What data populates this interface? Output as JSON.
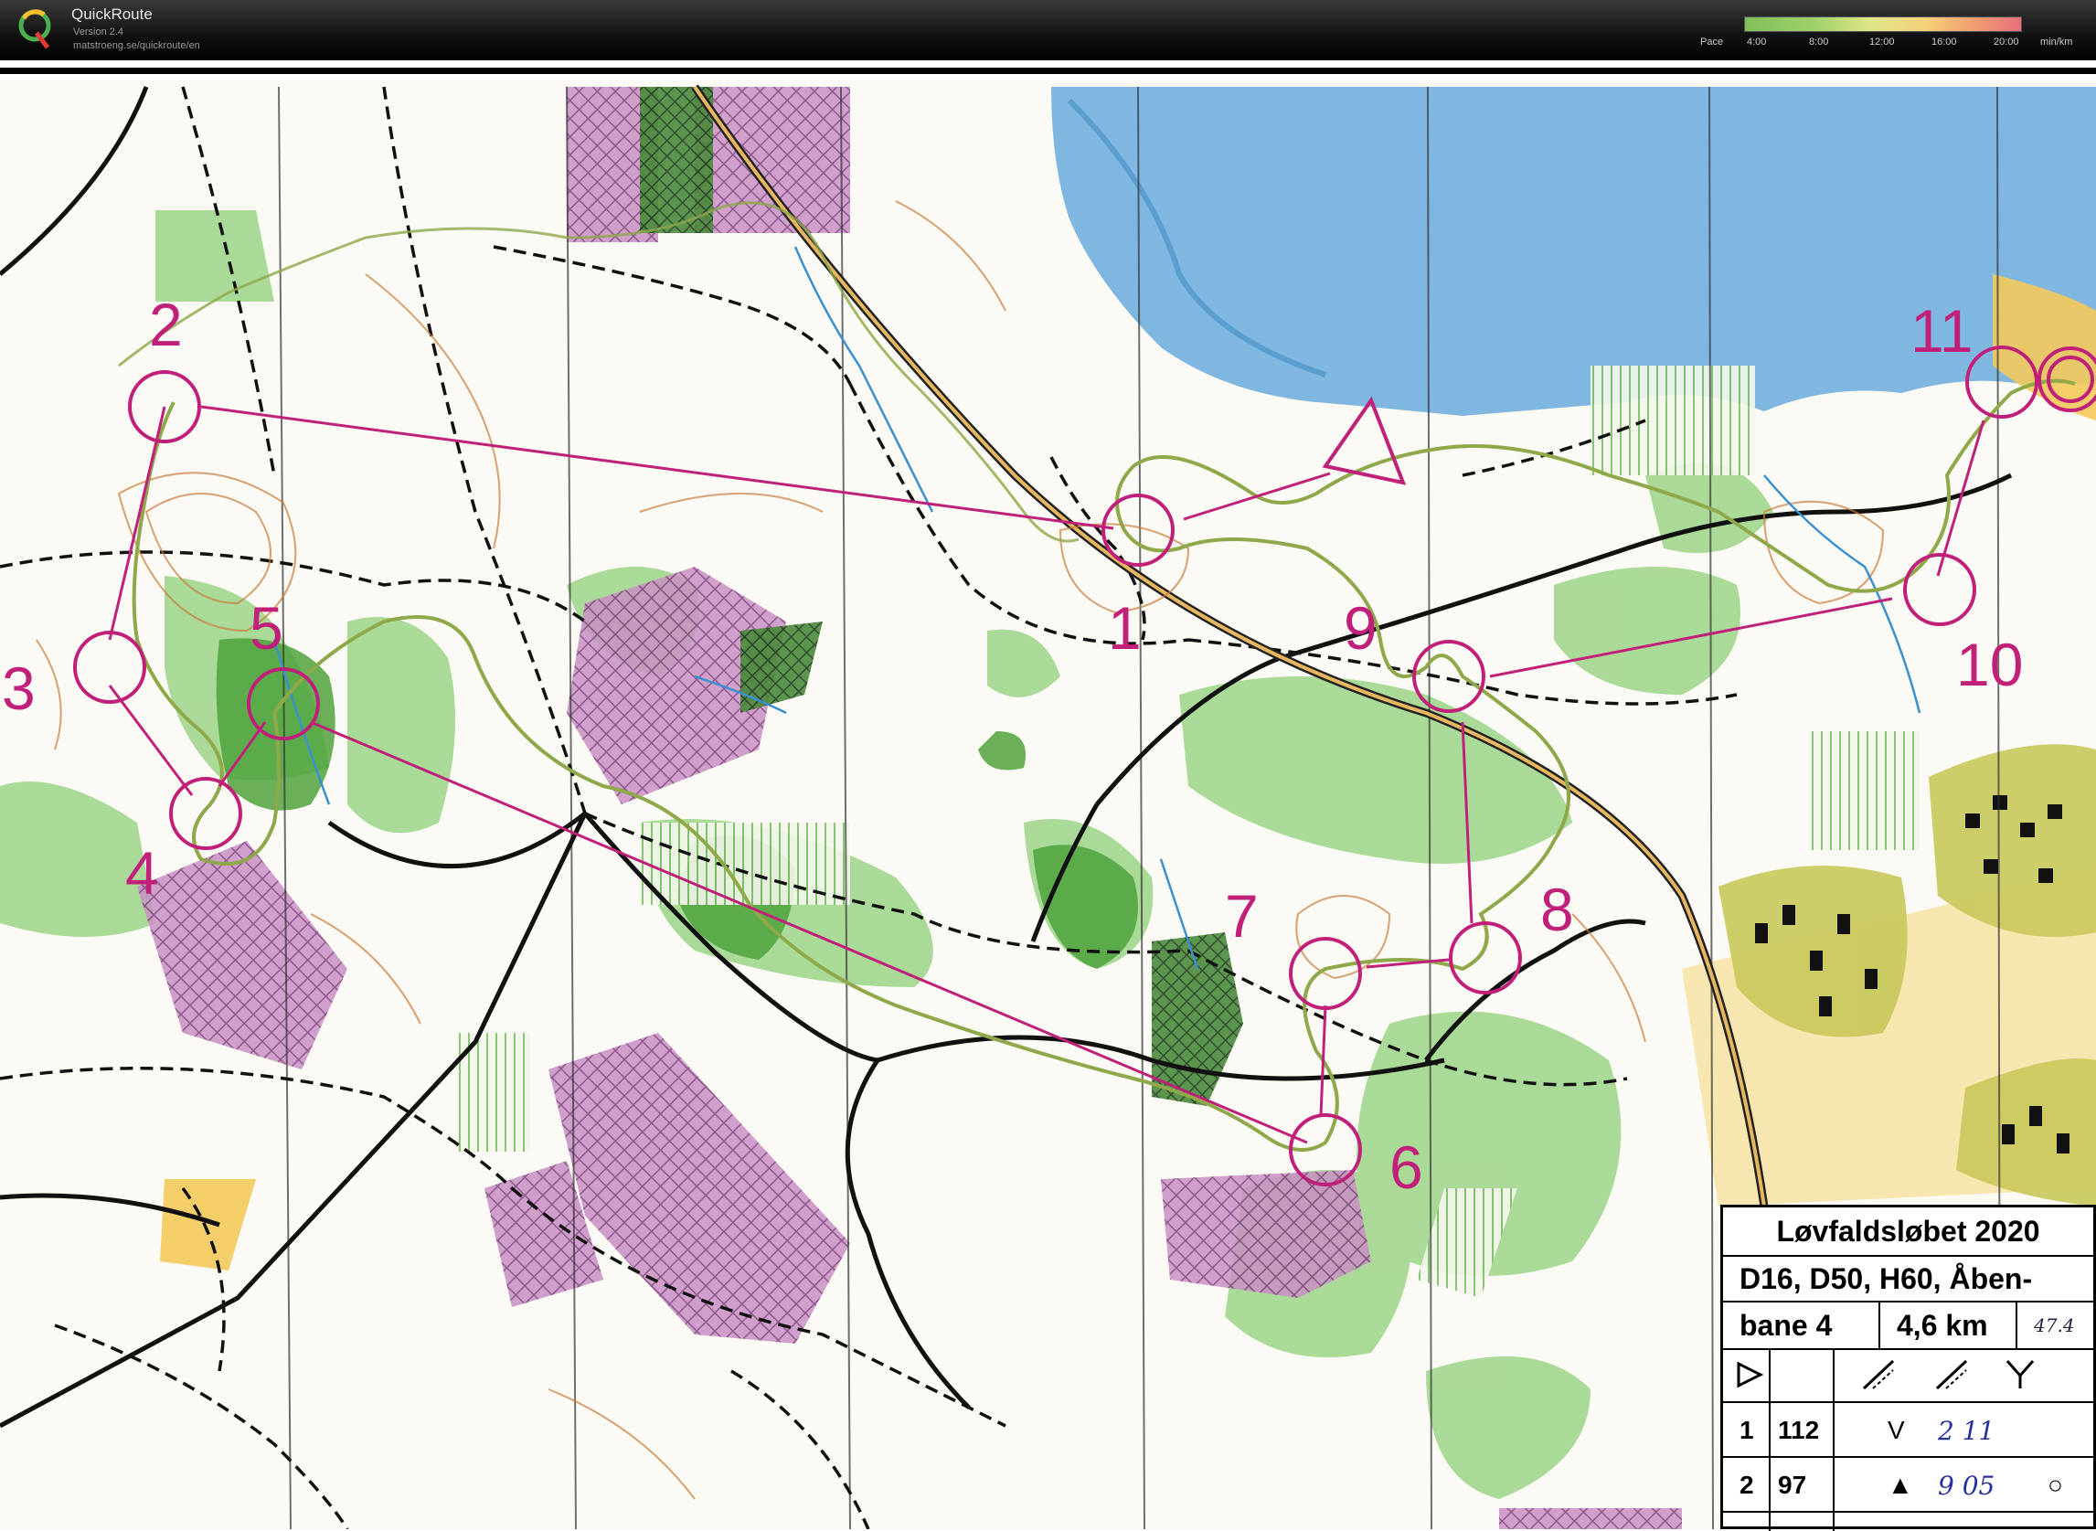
{
  "app": {
    "name": "QuickRoute",
    "version": "Version 2.4",
    "url": "matstroeng.se/quickroute/en"
  },
  "pace_legend": {
    "label": "Pace",
    "ticks": [
      "4:00",
      "8:00",
      "12:00",
      "16:00",
      "20:00"
    ],
    "unit": "min/km"
  },
  "map": {
    "control_numbers": [
      "1",
      "2",
      "3",
      "4",
      "5",
      "6",
      "7",
      "8",
      "9",
      "10",
      "11"
    ],
    "course_color": "#c0207a",
    "route_color": "#8fa84a"
  },
  "legend": {
    "title": "Løvfaldsløbet 2020",
    "classes": "D16, D50, H60, Åben-",
    "course_name": "bane 4",
    "course_length": "4,6 km",
    "course_note": "47.4",
    "rows": [
      {
        "num": "1",
        "code": "112",
        "symbol": "V",
        "note": "2 11"
      },
      {
        "num": "2",
        "code": "97",
        "symbol": "▲",
        "note": "9 05",
        "extra": "○"
      }
    ]
  }
}
